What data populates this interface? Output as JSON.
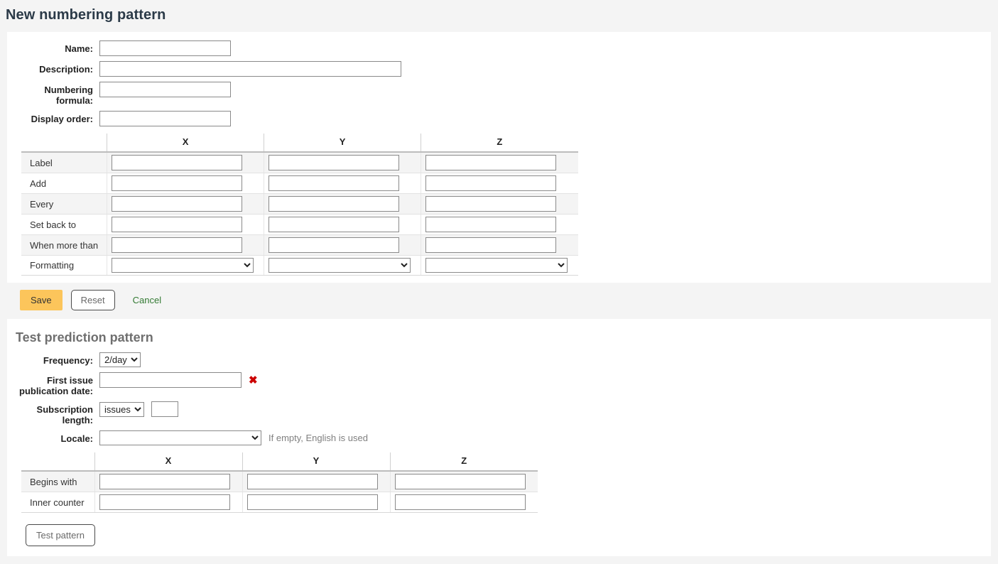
{
  "page": {
    "title": "New numbering pattern"
  },
  "numbering_form": {
    "fields": [
      {
        "label": "Name:",
        "value": "",
        "name": "name"
      },
      {
        "label": "Description:",
        "value": "",
        "name": "description"
      },
      {
        "label": "Numbering formula:",
        "value": "",
        "name": "numbering-formula"
      },
      {
        "label": "Display order:",
        "value": "",
        "name": "display-order"
      }
    ]
  },
  "pattern_table": {
    "columns": [
      "",
      "X",
      "Y",
      "Z"
    ],
    "rows": [
      {
        "label": "Label",
        "type": "text",
        "values": [
          "",
          "",
          ""
        ]
      },
      {
        "label": "Add",
        "type": "text",
        "values": [
          "",
          "",
          ""
        ]
      },
      {
        "label": "Every",
        "type": "text",
        "values": [
          "",
          "",
          ""
        ]
      },
      {
        "label": "Set back to",
        "type": "text",
        "values": [
          "",
          "",
          ""
        ]
      },
      {
        "label": "When more than",
        "type": "text",
        "values": [
          "",
          "",
          ""
        ]
      },
      {
        "label": "Formatting",
        "type": "select",
        "values": [
          "",
          "",
          ""
        ]
      }
    ]
  },
  "actions": {
    "save_label": "Save",
    "reset_label": "Reset",
    "cancel_label": "Cancel",
    "save_color": "#fcc55b",
    "cancel_color": "#337a33"
  },
  "test_section": {
    "title": "Test prediction pattern",
    "frequency": {
      "label": "Frequency:",
      "value": "2/day"
    },
    "first_issue": {
      "label": "First issue publication date:",
      "value": "",
      "required_marker": "✖",
      "required_color": "#cc0000"
    },
    "subscription_length": {
      "label": "Subscription length:",
      "unit_value": "issues",
      "amount_value": ""
    },
    "locale": {
      "label": "Locale:",
      "value": "",
      "hint": "If empty, English is used"
    },
    "table": {
      "columns": [
        "",
        "X",
        "Y",
        "Z"
      ],
      "rows": [
        {
          "label": "Begins with",
          "values": [
            "",
            "",
            ""
          ]
        },
        {
          "label": "Inner counter",
          "values": [
            "",
            "",
            ""
          ]
        }
      ]
    },
    "test_button_label": "Test pattern"
  }
}
